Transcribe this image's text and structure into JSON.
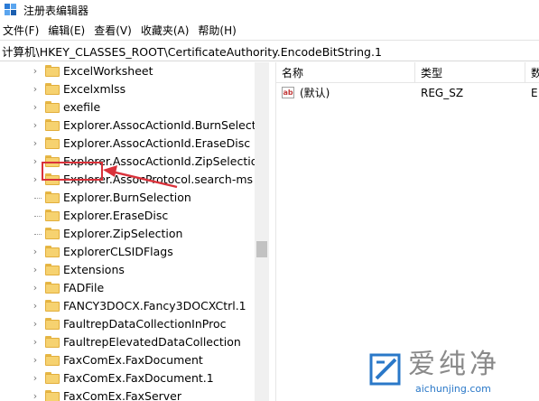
{
  "window": {
    "title": "注册表编辑器"
  },
  "menu": {
    "items": [
      "文件(F)",
      "编辑(E)",
      "查看(V)",
      "收藏夹(A)",
      "帮助(H)"
    ]
  },
  "address": {
    "path": "计算机\\HKEY_CLASSES_ROOT\\CertificateAuthority.EncodeBitString.1"
  },
  "tree": {
    "items": [
      {
        "label": "ExcelWorksheet",
        "expander": "chevron"
      },
      {
        "label": "Excelxmlss",
        "expander": "chevron"
      },
      {
        "label": "exefile",
        "expander": "chevron",
        "highlighted": true
      },
      {
        "label": "Explorer.AssocActionId.BurnSelection",
        "expander": "chevron"
      },
      {
        "label": "Explorer.AssocActionId.EraseDisc",
        "expander": "chevron"
      },
      {
        "label": "Explorer.AssocActionId.ZipSelection",
        "expander": "chevron"
      },
      {
        "label": "Explorer.AssocProtocol.search-ms",
        "expander": "chevron"
      },
      {
        "label": "Explorer.BurnSelection",
        "expander": "dotted"
      },
      {
        "label": "Explorer.EraseDisc",
        "expander": "dotted"
      },
      {
        "label": "Explorer.ZipSelection",
        "expander": "dotted"
      },
      {
        "label": "ExplorerCLSIDFlags",
        "expander": "chevron"
      },
      {
        "label": "Extensions",
        "expander": "chevron"
      },
      {
        "label": "FADFile",
        "expander": "chevron"
      },
      {
        "label": "FANCY3DOCX.Fancy3DOCXCtrl.1",
        "expander": "chevron"
      },
      {
        "label": "FaultrepDataCollectionInProc",
        "expander": "chevron"
      },
      {
        "label": "FaultrepElevatedDataCollection",
        "expander": "chevron"
      },
      {
        "label": "FaxComEx.FaxDocument",
        "expander": "chevron"
      },
      {
        "label": "FaxComEx.FaxDocument.1",
        "expander": "chevron"
      },
      {
        "label": "FaxComEx.FaxServer",
        "expander": "chevron"
      }
    ]
  },
  "values": {
    "columns": [
      "名称",
      "类型",
      "数据"
    ],
    "rows": [
      {
        "name": "(默认)",
        "type": "REG_SZ",
        "data": "E"
      }
    ]
  },
  "watermark": {
    "brand": "爱纯净",
    "url": "aichunjing.com"
  },
  "colors": {
    "annotation": "#d9313a",
    "folder": "#f6d270",
    "watermark_url": "#2a78c8"
  }
}
